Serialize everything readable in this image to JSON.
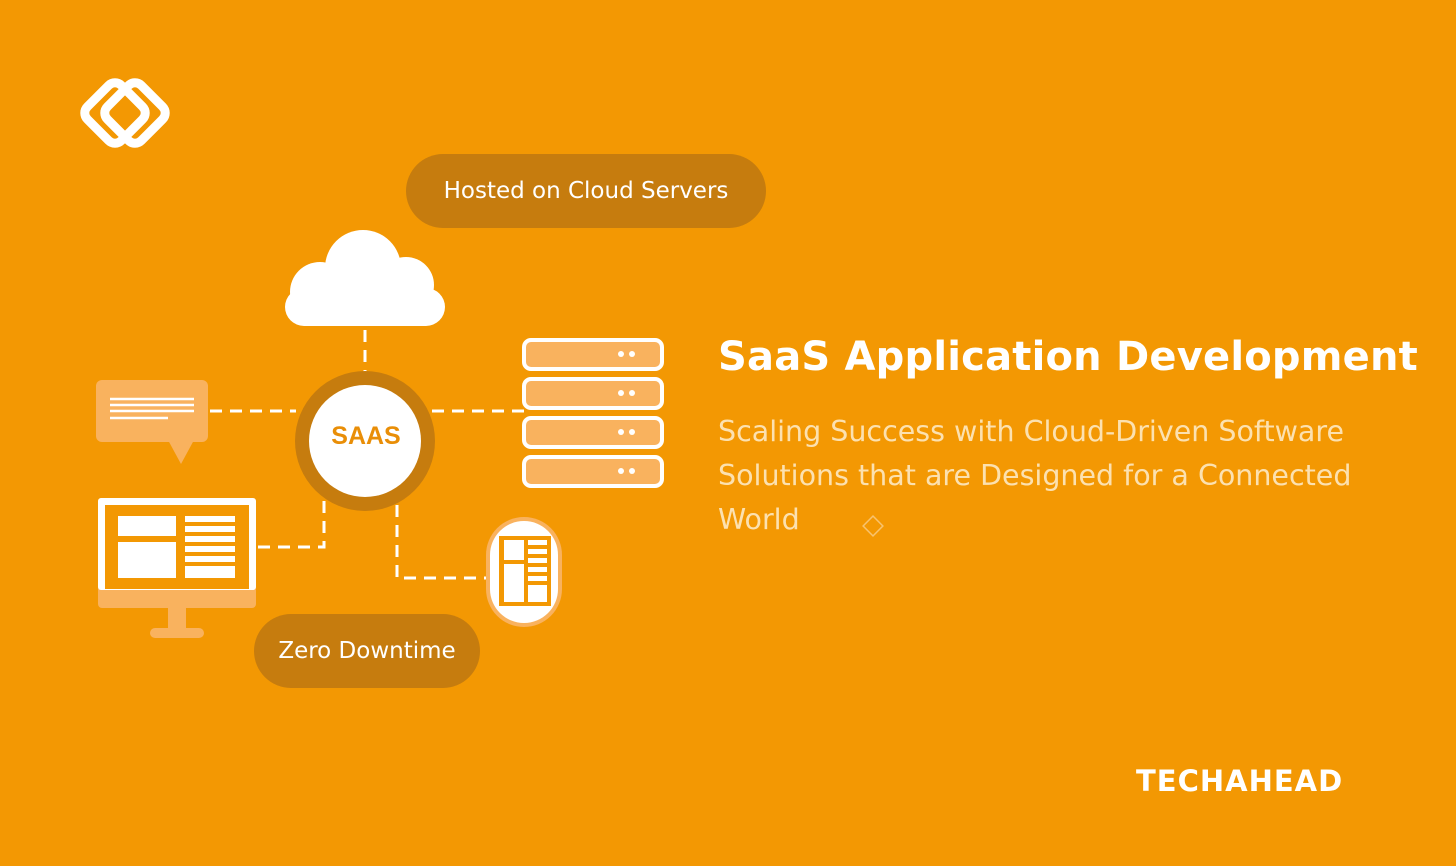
{
  "labels": {
    "hosted": "Hosted on Cloud Servers",
    "zero_downtime": "Zero Downtime",
    "saas_center": "SAAS"
  },
  "heading": {
    "title": "SaaS Application Development",
    "subtitle": "Scaling Success with Cloud-Driven Software Solutions that are Designed for a Connected World"
  },
  "brand": {
    "wordmark": "TECHAHEAD"
  },
  "icons": [
    "logo-icon",
    "cloud-icon",
    "server-rack-icon",
    "chat-bubble-icon",
    "monitor-icon",
    "mobile-phone-icon"
  ],
  "colors": {
    "background": "#F39803",
    "pill": "#C67C0E",
    "light_orange": "#F9B25E",
    "white": "#FFFFFF"
  }
}
